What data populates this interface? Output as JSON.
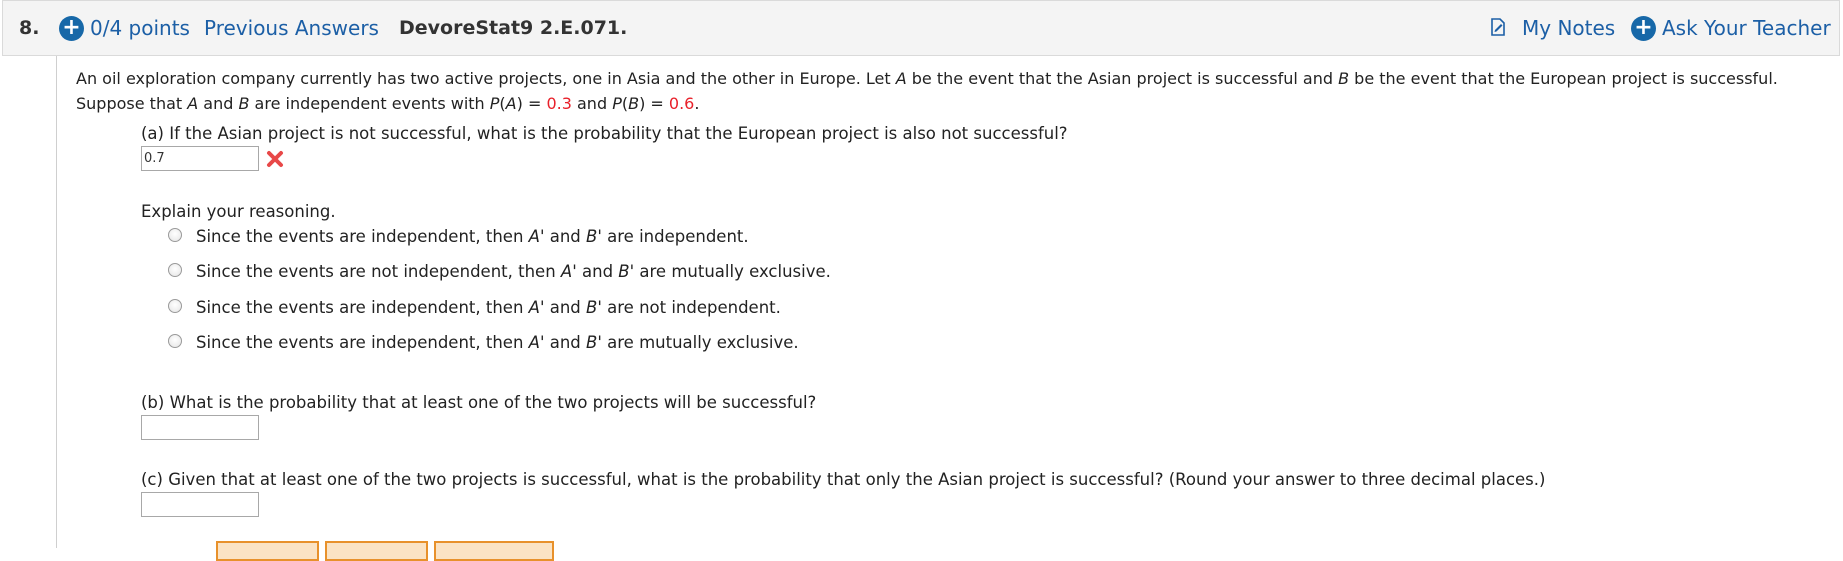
{
  "header": {
    "question_number": "8.",
    "points_label": "0/4 points",
    "previous_answers_label": "Previous Answers",
    "question_id": "DevoreStat9 2.E.071.",
    "my_notes_label": "My Notes",
    "ask_teacher_label": "Ask Your Teacher"
  },
  "problem": {
    "intro_line1_parts": [
      "An oil exploration company currently has two active projects, one in Asia and the other in Europe. Let ",
      "A",
      " be the event that the Asian project is successful and ",
      "B",
      " be the event that the European project is successful."
    ],
    "intro_line2_parts": [
      "Suppose that ",
      "A",
      " and ",
      "B",
      " are independent events with ",
      "P",
      "(",
      "A",
      ") = ",
      "0.3",
      " and ",
      "P",
      "(",
      "B",
      ") = ",
      "0.6",
      "."
    ]
  },
  "part_a": {
    "question": "(a) If the Asian project is not successful, what is the probability that the European project is also not successful?",
    "answer_value": "0.7",
    "explain_label": "Explain your reasoning.",
    "options": [
      {
        "before": "Since the events are independent, then ",
        "mid": " are independent."
      },
      {
        "before": "Since the events are not independent, then ",
        "mid": " are mutually exclusive."
      },
      {
        "before": "Since the events are independent, then ",
        "mid": " are not independent."
      },
      {
        "before": "Since the events are independent, then ",
        "mid": " are mutually exclusive."
      }
    ],
    "option_vars": [
      "A'",
      " and ",
      "B'"
    ]
  },
  "part_b": {
    "question": "(b) What is the probability that at least one of the two projects will be successful?",
    "answer_value": ""
  },
  "part_c": {
    "question": "(c) Given that at least one of the two projects is successful, what is the probability that only the Asian project is successful? (Round your answer to three decimal places.)",
    "answer_value": ""
  },
  "icons": {
    "plus": "plus-circle-icon",
    "notes": "notes-icon",
    "wrong": "x-mark-icon"
  },
  "colors": {
    "link": "#1c5fa6",
    "accent_blue": "#1768a8",
    "error_red": "#e8202a",
    "wrong_mark": "#e84848"
  }
}
